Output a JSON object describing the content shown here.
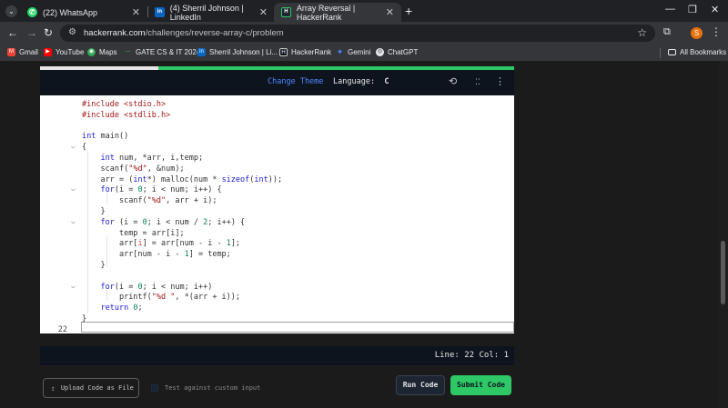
{
  "browser": {
    "tabs": [
      {
        "title": "(22) WhatsApp",
        "icon": "whatsapp-icon",
        "color": "#25d366",
        "glyph": "✆"
      },
      {
        "title": "(4) Sherril Johnson | LinkedIn",
        "icon": "linkedin-icon",
        "color": "#0a66c2",
        "glyph": "in"
      },
      {
        "title": "Array Reversal | HackerRank",
        "icon": "hackerrank-icon",
        "color": "#1c2530",
        "glyph": "H"
      }
    ],
    "url_domain": "hackerrank.com",
    "url_path": "/challenges/reverse-array-c/problem",
    "profile_initial": "S",
    "bookmarks": [
      {
        "label": "Gmail",
        "icon": "gmail-icon",
        "color": "#ea4335",
        "glyph": "M"
      },
      {
        "label": "YouTube",
        "icon": "youtube-icon",
        "color": "#ff0000",
        "glyph": "▶"
      },
      {
        "label": "Maps",
        "icon": "maps-icon",
        "color": "#34a853",
        "glyph": "◉"
      },
      {
        "label": "GATE CS & IT 2024",
        "icon": "gate-icon",
        "color": "#1e88e5",
        "glyph": "—"
      },
      {
        "label": "Sherril Johnson | Li...",
        "icon": "linkedin-icon",
        "color": "#0a66c2",
        "glyph": "in"
      },
      {
        "label": "HackerRank",
        "icon": "hackerrank-icon",
        "color": "#0e141e",
        "glyph": "H"
      },
      {
        "label": "Gemini",
        "icon": "gemini-icon",
        "color": "#4e88ff",
        "glyph": "✦"
      },
      {
        "label": "ChatGPT",
        "icon": "chatgpt-icon",
        "color": "#555555",
        "glyph": "◎"
      }
    ],
    "all_bookmarks": "All Bookmarks"
  },
  "challenge": {
    "progress_pct": 25
  },
  "editor": {
    "change_theme": "Change Theme",
    "language_label": "Language:",
    "language_value": "C",
    "lines": [
      {
        "num": "",
        "html": "<span class='s'>#include &lt;stdio.h&gt;</span>"
      },
      {
        "num": "",
        "html": "<span class='s'>#include &lt;stdlib.h&gt;</span>"
      },
      {
        "num": "",
        "html": ""
      },
      {
        "num": "",
        "html": "<span class='k'>int</span> <span class='t'>main()</span>"
      },
      {
        "num": "",
        "html": "<span class='t'>{</span>",
        "fold": true
      },
      {
        "num": "",
        "html": "    <span class='k'>int</span> <span class='t'>num, *arr, i,temp;</span>"
      },
      {
        "num": "",
        "html": "    <span class='t'>scanf(</span><span class='s'>\"%d\"</span><span class='t'>, &amp;num);</span>"
      },
      {
        "num": "",
        "html": "    <span class='t'>arr = (</span><span class='k'>int</span><span class='t'>*) malloc(num * </span><span class='k'>sizeof</span><span class='t'>(</span><span class='k'>int</span><span class='t'>));</span>"
      },
      {
        "num": "",
        "html": "    <span class='k'>for</span><span class='t'>(i = </span><span class='n'>0</span><span class='t'>; i &lt; num; i++) {</span>",
        "fold": true
      },
      {
        "num": "",
        "html": "        <span class='t'>scanf(</span><span class='s'>\"%d\"</span><span class='t'>, arr + i);</span>"
      },
      {
        "num": "",
        "html": "    <span class='t'>}</span>"
      },
      {
        "num": "",
        "html": "    <span class='k'>for</span> <span class='t'>(i = </span><span class='n'>0</span><span class='t'>; i &lt; num / </span><span class='n'>2</span><span class='t'>; i++) {</span>",
        "fold": true
      },
      {
        "num": "",
        "html": "        <span class='t'>temp = arr[i];</span>"
      },
      {
        "num": "",
        "html": "        <span class='t'>arr[</span><span class='p'>i</span><span class='t'>] = arr[num - i - </span><span class='n'>1</span><span class='t'>];</span>"
      },
      {
        "num": "",
        "html": "        <span class='t'>arr[num - i - </span><span class='n'>1</span><span class='t'>] = temp;</span>"
      },
      {
        "num": "",
        "html": "    <span class='t'>}</span>"
      },
      {
        "num": "",
        "html": ""
      },
      {
        "num": "",
        "html": "    <span class='k'>for</span><span class='t'>(i = </span><span class='n'>0</span><span class='t'>; i &lt; num; i++)</span>",
        "fold": true
      },
      {
        "num": "",
        "html": "        <span class='t'>printf(</span><span class='s'>\"%d \"</span><span class='t'>, *(arr + i));</span>"
      },
      {
        "num": "",
        "html": "    <span class='k'>return</span> <span class='n'>0</span><span class='t'>;</span>"
      },
      {
        "num": "",
        "html": "<span class='t'>}</span>"
      },
      {
        "num": "22",
        "html": ""
      }
    ],
    "status": "Line: 22 Col: 1"
  },
  "actions": {
    "upload": "Upload Code as File",
    "custom_input": "Test against custom input",
    "run": "Run Code",
    "submit": "Submit Code"
  }
}
